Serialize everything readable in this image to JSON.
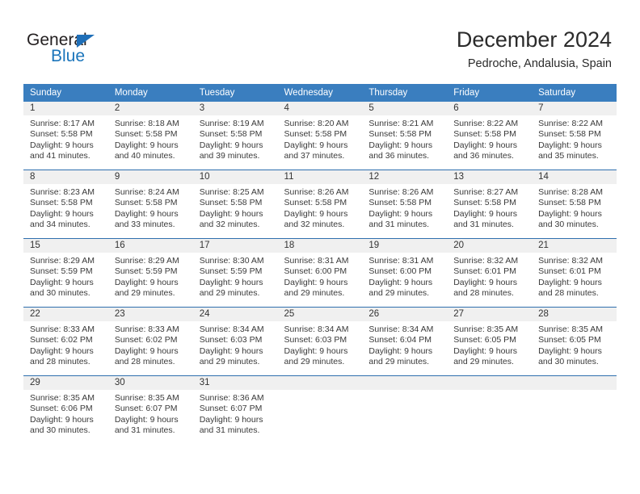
{
  "brand": {
    "name_top": "General",
    "name_bottom": "Blue",
    "color_dark": "#231f20",
    "color_blue": "#1b75bb"
  },
  "header": {
    "title": "December 2024",
    "subtitle": "Pedroche, Andalusia, Spain"
  },
  "theme": {
    "header_row_bg": "#3a7ebf",
    "week_separator": "#2f6fae",
    "daynum_bg": "#f0f0f0",
    "text": "#3a3a3a"
  },
  "weekdays": [
    "Sunday",
    "Monday",
    "Tuesday",
    "Wednesday",
    "Thursday",
    "Friday",
    "Saturday"
  ],
  "weeks": [
    [
      {
        "day": "1",
        "sunrise": "Sunrise: 8:17 AM",
        "sunset": "Sunset: 5:58 PM",
        "daylight1": "Daylight: 9 hours",
        "daylight2": "and 41 minutes."
      },
      {
        "day": "2",
        "sunrise": "Sunrise: 8:18 AM",
        "sunset": "Sunset: 5:58 PM",
        "daylight1": "Daylight: 9 hours",
        "daylight2": "and 40 minutes."
      },
      {
        "day": "3",
        "sunrise": "Sunrise: 8:19 AM",
        "sunset": "Sunset: 5:58 PM",
        "daylight1": "Daylight: 9 hours",
        "daylight2": "and 39 minutes."
      },
      {
        "day": "4",
        "sunrise": "Sunrise: 8:20 AM",
        "sunset": "Sunset: 5:58 PM",
        "daylight1": "Daylight: 9 hours",
        "daylight2": "and 37 minutes."
      },
      {
        "day": "5",
        "sunrise": "Sunrise: 8:21 AM",
        "sunset": "Sunset: 5:58 PM",
        "daylight1": "Daylight: 9 hours",
        "daylight2": "and 36 minutes."
      },
      {
        "day": "6",
        "sunrise": "Sunrise: 8:22 AM",
        "sunset": "Sunset: 5:58 PM",
        "daylight1": "Daylight: 9 hours",
        "daylight2": "and 36 minutes."
      },
      {
        "day": "7",
        "sunrise": "Sunrise: 8:22 AM",
        "sunset": "Sunset: 5:58 PM",
        "daylight1": "Daylight: 9 hours",
        "daylight2": "and 35 minutes."
      }
    ],
    [
      {
        "day": "8",
        "sunrise": "Sunrise: 8:23 AM",
        "sunset": "Sunset: 5:58 PM",
        "daylight1": "Daylight: 9 hours",
        "daylight2": "and 34 minutes."
      },
      {
        "day": "9",
        "sunrise": "Sunrise: 8:24 AM",
        "sunset": "Sunset: 5:58 PM",
        "daylight1": "Daylight: 9 hours",
        "daylight2": "and 33 minutes."
      },
      {
        "day": "10",
        "sunrise": "Sunrise: 8:25 AM",
        "sunset": "Sunset: 5:58 PM",
        "daylight1": "Daylight: 9 hours",
        "daylight2": "and 32 minutes."
      },
      {
        "day": "11",
        "sunrise": "Sunrise: 8:26 AM",
        "sunset": "Sunset: 5:58 PM",
        "daylight1": "Daylight: 9 hours",
        "daylight2": "and 32 minutes."
      },
      {
        "day": "12",
        "sunrise": "Sunrise: 8:26 AM",
        "sunset": "Sunset: 5:58 PM",
        "daylight1": "Daylight: 9 hours",
        "daylight2": "and 31 minutes."
      },
      {
        "day": "13",
        "sunrise": "Sunrise: 8:27 AM",
        "sunset": "Sunset: 5:58 PM",
        "daylight1": "Daylight: 9 hours",
        "daylight2": "and 31 minutes."
      },
      {
        "day": "14",
        "sunrise": "Sunrise: 8:28 AM",
        "sunset": "Sunset: 5:58 PM",
        "daylight1": "Daylight: 9 hours",
        "daylight2": "and 30 minutes."
      }
    ],
    [
      {
        "day": "15",
        "sunrise": "Sunrise: 8:29 AM",
        "sunset": "Sunset: 5:59 PM",
        "daylight1": "Daylight: 9 hours",
        "daylight2": "and 30 minutes."
      },
      {
        "day": "16",
        "sunrise": "Sunrise: 8:29 AM",
        "sunset": "Sunset: 5:59 PM",
        "daylight1": "Daylight: 9 hours",
        "daylight2": "and 29 minutes."
      },
      {
        "day": "17",
        "sunrise": "Sunrise: 8:30 AM",
        "sunset": "Sunset: 5:59 PM",
        "daylight1": "Daylight: 9 hours",
        "daylight2": "and 29 minutes."
      },
      {
        "day": "18",
        "sunrise": "Sunrise: 8:31 AM",
        "sunset": "Sunset: 6:00 PM",
        "daylight1": "Daylight: 9 hours",
        "daylight2": "and 29 minutes."
      },
      {
        "day": "19",
        "sunrise": "Sunrise: 8:31 AM",
        "sunset": "Sunset: 6:00 PM",
        "daylight1": "Daylight: 9 hours",
        "daylight2": "and 29 minutes."
      },
      {
        "day": "20",
        "sunrise": "Sunrise: 8:32 AM",
        "sunset": "Sunset: 6:01 PM",
        "daylight1": "Daylight: 9 hours",
        "daylight2": "and 28 minutes."
      },
      {
        "day": "21",
        "sunrise": "Sunrise: 8:32 AM",
        "sunset": "Sunset: 6:01 PM",
        "daylight1": "Daylight: 9 hours",
        "daylight2": "and 28 minutes."
      }
    ],
    [
      {
        "day": "22",
        "sunrise": "Sunrise: 8:33 AM",
        "sunset": "Sunset: 6:02 PM",
        "daylight1": "Daylight: 9 hours",
        "daylight2": "and 28 minutes."
      },
      {
        "day": "23",
        "sunrise": "Sunrise: 8:33 AM",
        "sunset": "Sunset: 6:02 PM",
        "daylight1": "Daylight: 9 hours",
        "daylight2": "and 28 minutes."
      },
      {
        "day": "24",
        "sunrise": "Sunrise: 8:34 AM",
        "sunset": "Sunset: 6:03 PM",
        "daylight1": "Daylight: 9 hours",
        "daylight2": "and 29 minutes."
      },
      {
        "day": "25",
        "sunrise": "Sunrise: 8:34 AM",
        "sunset": "Sunset: 6:03 PM",
        "daylight1": "Daylight: 9 hours",
        "daylight2": "and 29 minutes."
      },
      {
        "day": "26",
        "sunrise": "Sunrise: 8:34 AM",
        "sunset": "Sunset: 6:04 PM",
        "daylight1": "Daylight: 9 hours",
        "daylight2": "and 29 minutes."
      },
      {
        "day": "27",
        "sunrise": "Sunrise: 8:35 AM",
        "sunset": "Sunset: 6:05 PM",
        "daylight1": "Daylight: 9 hours",
        "daylight2": "and 29 minutes."
      },
      {
        "day": "28",
        "sunrise": "Sunrise: 8:35 AM",
        "sunset": "Sunset: 6:05 PM",
        "daylight1": "Daylight: 9 hours",
        "daylight2": "and 30 minutes."
      }
    ],
    [
      {
        "day": "29",
        "sunrise": "Sunrise: 8:35 AM",
        "sunset": "Sunset: 6:06 PM",
        "daylight1": "Daylight: 9 hours",
        "daylight2": "and 30 minutes."
      },
      {
        "day": "30",
        "sunrise": "Sunrise: 8:35 AM",
        "sunset": "Sunset: 6:07 PM",
        "daylight1": "Daylight: 9 hours",
        "daylight2": "and 31 minutes."
      },
      {
        "day": "31",
        "sunrise": "Sunrise: 8:36 AM",
        "sunset": "Sunset: 6:07 PM",
        "daylight1": "Daylight: 9 hours",
        "daylight2": "and 31 minutes."
      },
      {
        "day": "",
        "sunrise": "",
        "sunset": "",
        "daylight1": "",
        "daylight2": ""
      },
      {
        "day": "",
        "sunrise": "",
        "sunset": "",
        "daylight1": "",
        "daylight2": ""
      },
      {
        "day": "",
        "sunrise": "",
        "sunset": "",
        "daylight1": "",
        "daylight2": ""
      },
      {
        "day": "",
        "sunrise": "",
        "sunset": "",
        "daylight1": "",
        "daylight2": ""
      }
    ]
  ]
}
